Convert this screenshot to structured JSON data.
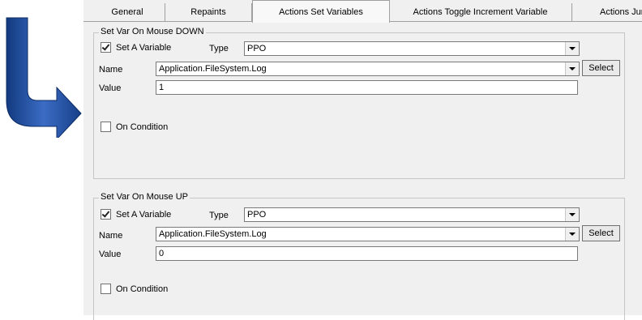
{
  "tabs": [
    {
      "label": "General"
    },
    {
      "label": "Repaints"
    },
    {
      "label": "Actions Set Variables"
    },
    {
      "label": "Actions Toggle Increment Variable"
    },
    {
      "label": "Actions Jur"
    }
  ],
  "down": {
    "legend": "Set Var On Mouse DOWN",
    "set_var_label": "Set A Variable",
    "type_label": "Type",
    "type_value": "PPO",
    "name_label": "Name",
    "name_value": "Application.FileSystem.Log",
    "select_label": "Select",
    "value_label": "Value",
    "value_value": "1",
    "on_condition_label": "On Condition"
  },
  "up": {
    "legend": "Set Var On Mouse UP",
    "set_var_label": "Set A Variable",
    "type_label": "Type",
    "type_value": "PPO",
    "name_label": "Name",
    "name_value": "Application.FileSystem.Log",
    "select_label": "Select",
    "value_label": "Value",
    "value_value": "0",
    "on_condition_label": "On Condition"
  },
  "colors": {
    "arrow": "#1f4f9c",
    "panel": "#f0f0f0",
    "border": "#a0a0a0"
  }
}
